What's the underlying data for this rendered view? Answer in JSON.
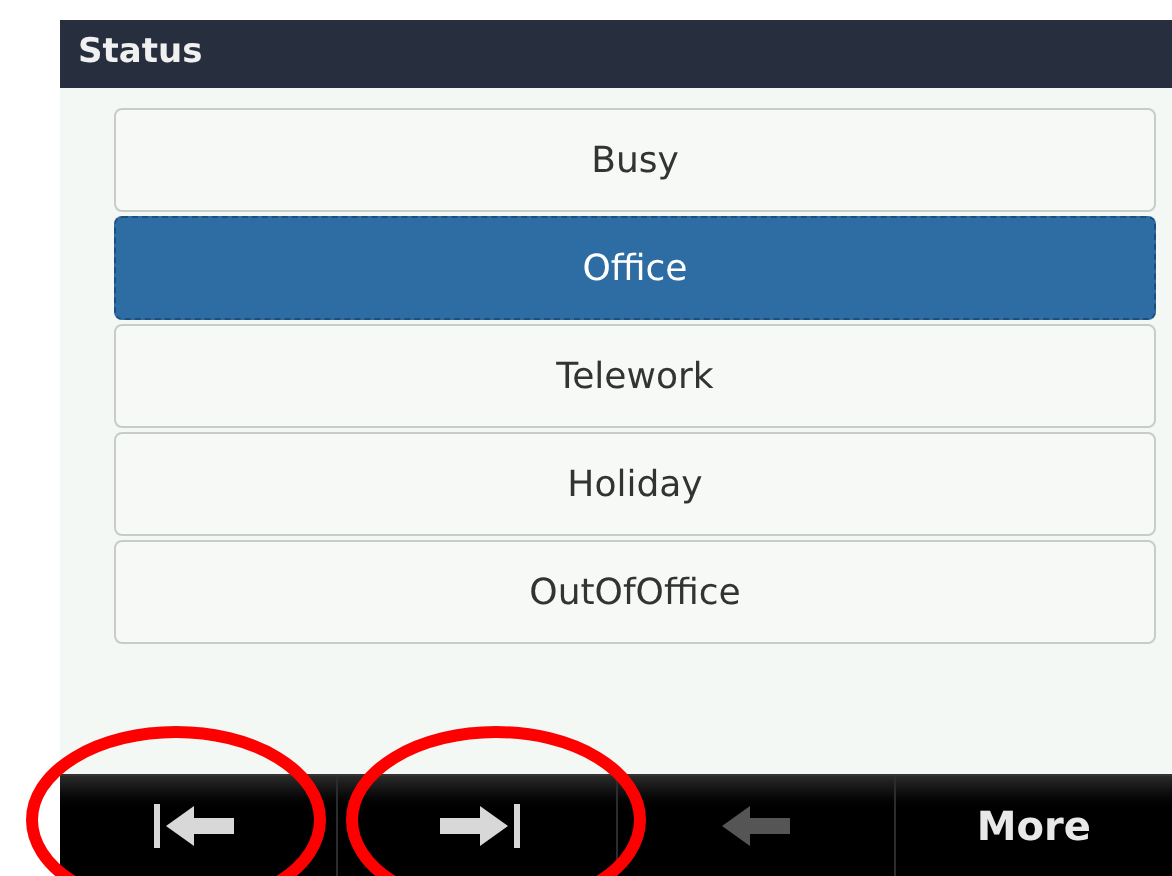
{
  "title": "Status",
  "items": [
    {
      "label": "Busy",
      "selected": false
    },
    {
      "label": "Office",
      "selected": true
    },
    {
      "label": "Telework",
      "selected": false
    },
    {
      "label": "Holiday",
      "selected": false
    },
    {
      "label": "OutOfOffice",
      "selected": false
    }
  ],
  "softkeys": [
    {
      "kind": "first",
      "disabled": false,
      "highlighted": true
    },
    {
      "kind": "last",
      "disabled": false,
      "highlighted": true
    },
    {
      "kind": "back",
      "disabled": true,
      "highlighted": false
    },
    {
      "kind": "text",
      "label": "More",
      "disabled": false,
      "highlighted": false
    }
  ]
}
